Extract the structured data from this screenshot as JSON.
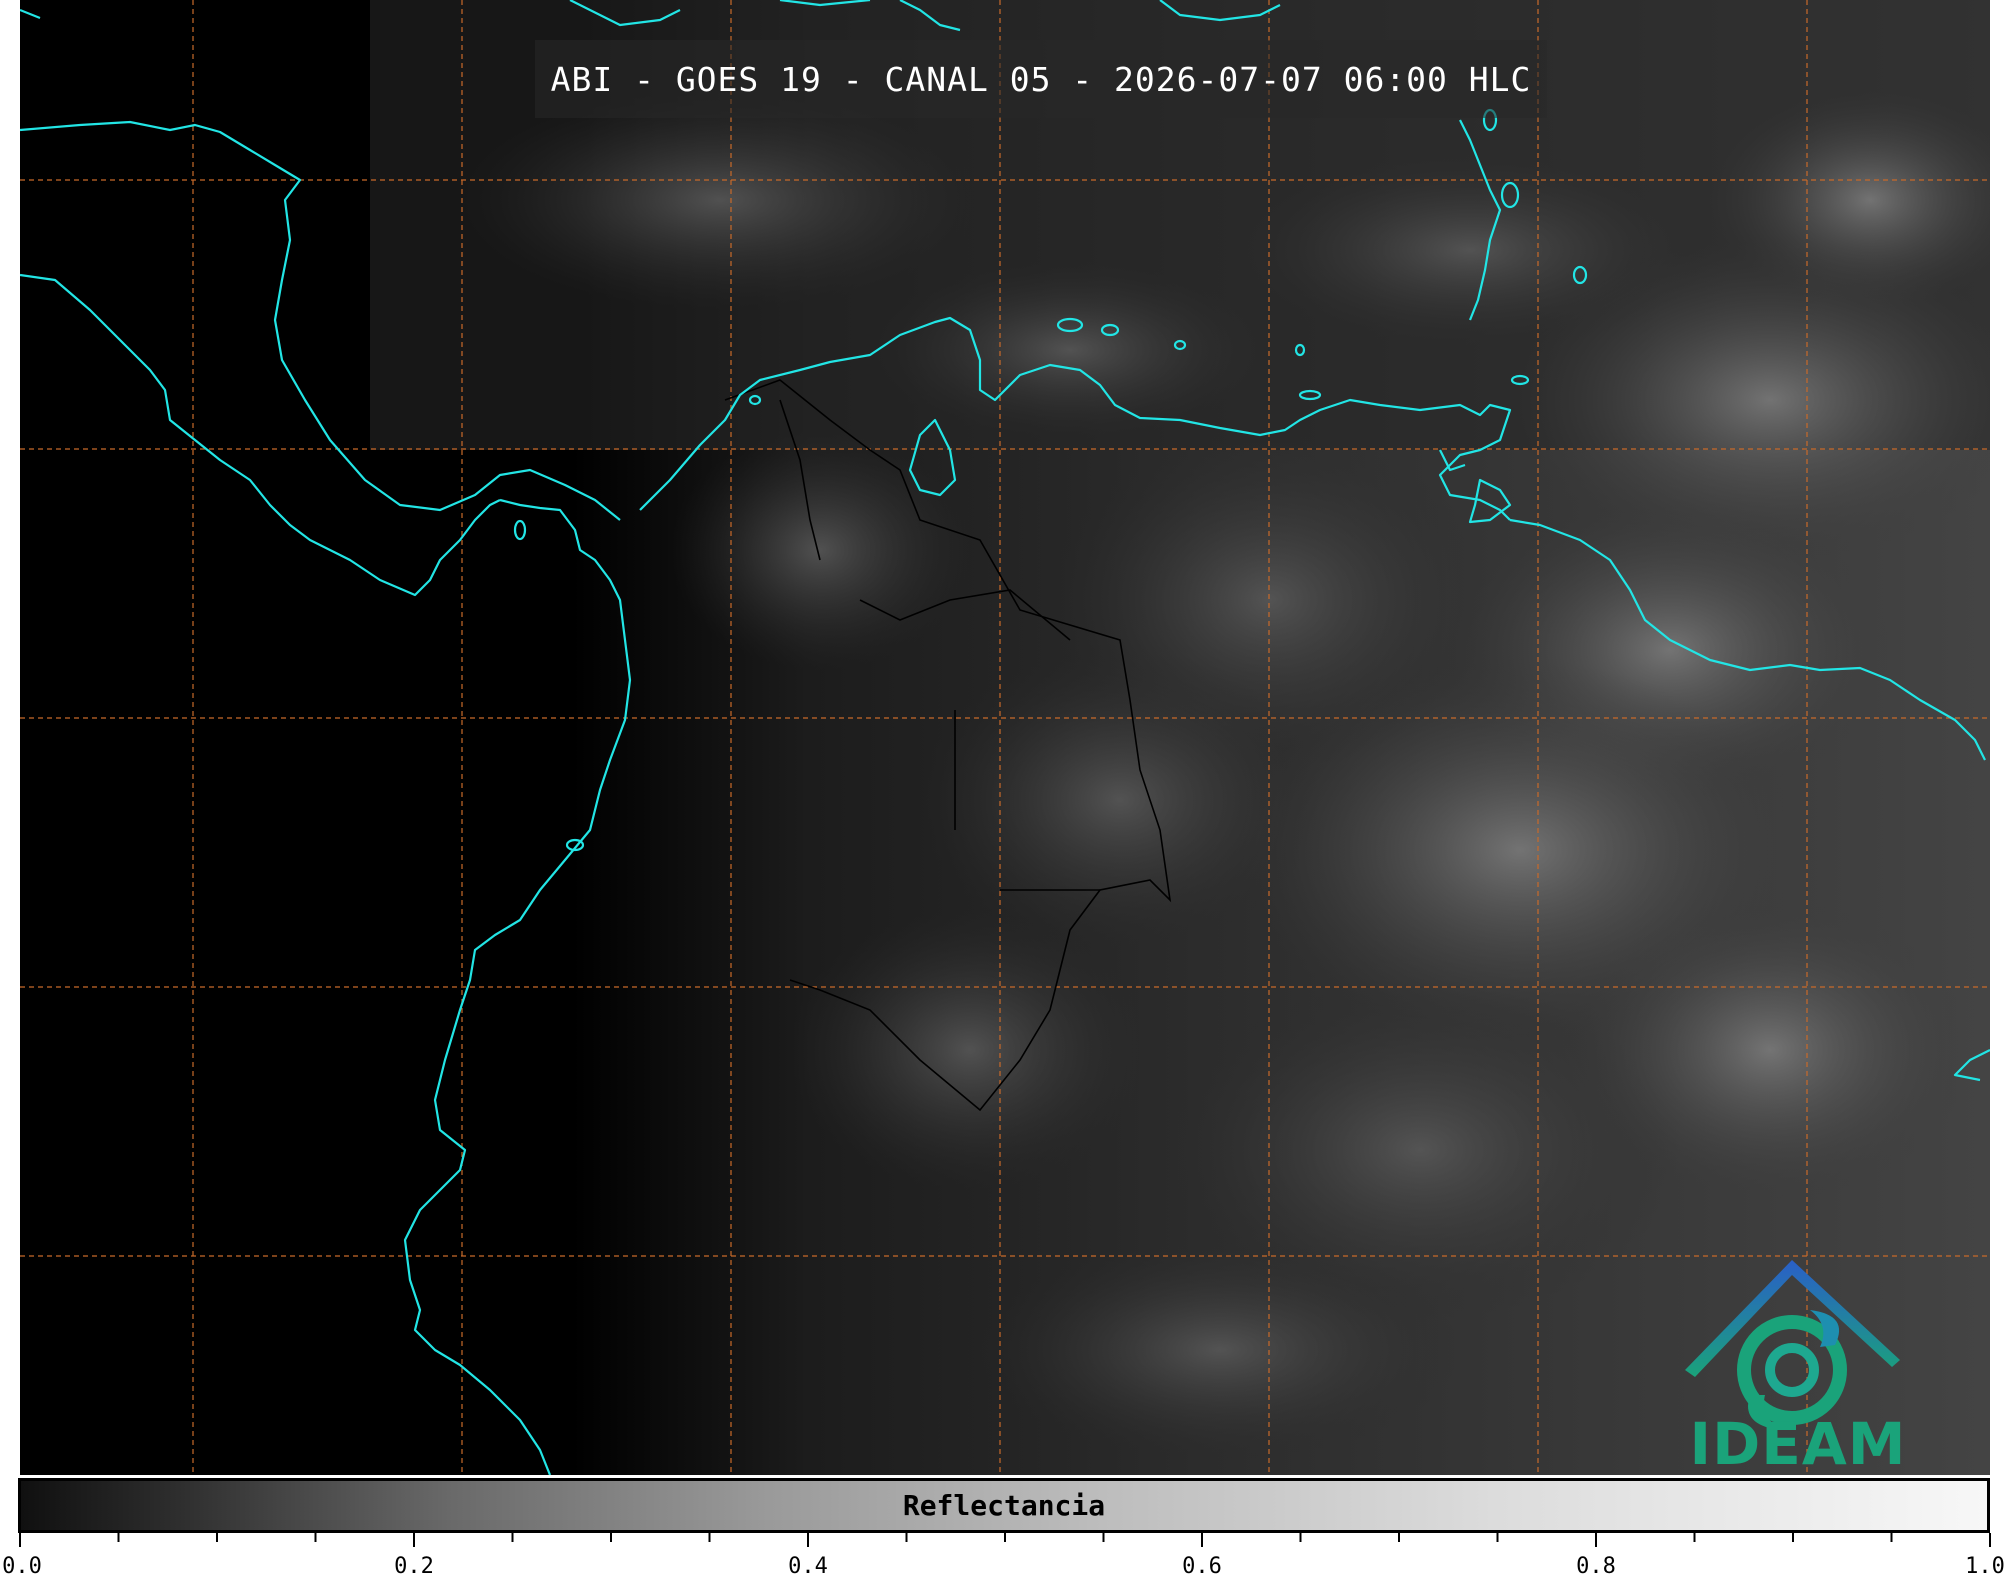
{
  "title": "ABI - GOES 19 - CANAL 05 - 2026-07-07 06:00 HLC",
  "logo": {
    "text": "IDEAM",
    "icon": "ideam-logo-icon",
    "color": "#1aa37a"
  },
  "colorbar": {
    "label": "Reflectancia",
    "ticks": [
      "0.0",
      "0.2",
      "0.4",
      "0.6",
      "0.8",
      "1.0"
    ],
    "range": [
      0.0,
      1.0
    ]
  },
  "colors": {
    "coastline": "#22e5e5",
    "gridlines": "#c86a2a",
    "borders": "#000000"
  }
}
